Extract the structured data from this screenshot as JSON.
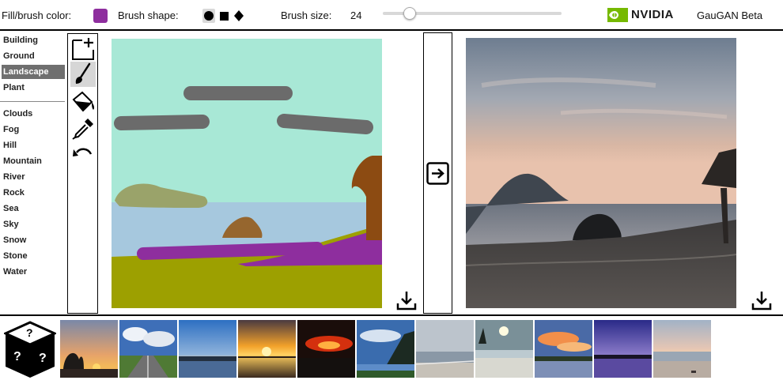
{
  "toolbar": {
    "fill_label": "Fill/brush color:",
    "fill_color": "#8e2e9e",
    "brush_shape_label": "Brush shape:",
    "brush_shapes": [
      "circle",
      "square",
      "diamond"
    ],
    "brush_shape_selected": "circle",
    "brush_size_label": "Brush size:",
    "brush_size_value": "24",
    "brush_size_fraction": 0.15,
    "brand": "NVIDIA",
    "app_title": "GauGAN Beta"
  },
  "labels": {
    "group1": [
      "Building",
      "Ground",
      "Landscape",
      "Plant"
    ],
    "group2": [
      "Clouds",
      "Fog",
      "Hill",
      "Mountain",
      "River",
      "Rock",
      "Sea",
      "Sky",
      "Snow",
      "Stone",
      "Water"
    ],
    "selected": "Landscape"
  },
  "tools": [
    "new-canvas-icon",
    "brush-icon",
    "fill-bucket-icon",
    "eyedropper-icon",
    "undo-icon"
  ],
  "tools_selected": "brush-icon",
  "segmentation_colors": {
    "sky": "#a8e8d6",
    "sea": "#a6c8de",
    "ground": "#9da000",
    "cloud": "#6b6b6b",
    "hill": "#9aa36a",
    "rock": "#96662e",
    "tree": "#8c4b12",
    "landscape": "#8e2e9e"
  },
  "icons": {
    "download": "download-icon",
    "transfer": "arrow-right-icon",
    "random": "dice-icon"
  },
  "thumbnails": [
    {
      "name": "thumb-sunset-tree"
    },
    {
      "name": "thumb-road-clouds"
    },
    {
      "name": "thumb-blue-dusk-lake"
    },
    {
      "name": "thumb-golden-sunset"
    },
    {
      "name": "thumb-red-sunset"
    },
    {
      "name": "thumb-mountain-bay"
    },
    {
      "name": "thumb-overcast-beach"
    },
    {
      "name": "thumb-sun-beach"
    },
    {
      "name": "thumb-orange-clouds"
    },
    {
      "name": "thumb-purple-lake"
    },
    {
      "name": "thumb-pastel-beach"
    }
  ]
}
